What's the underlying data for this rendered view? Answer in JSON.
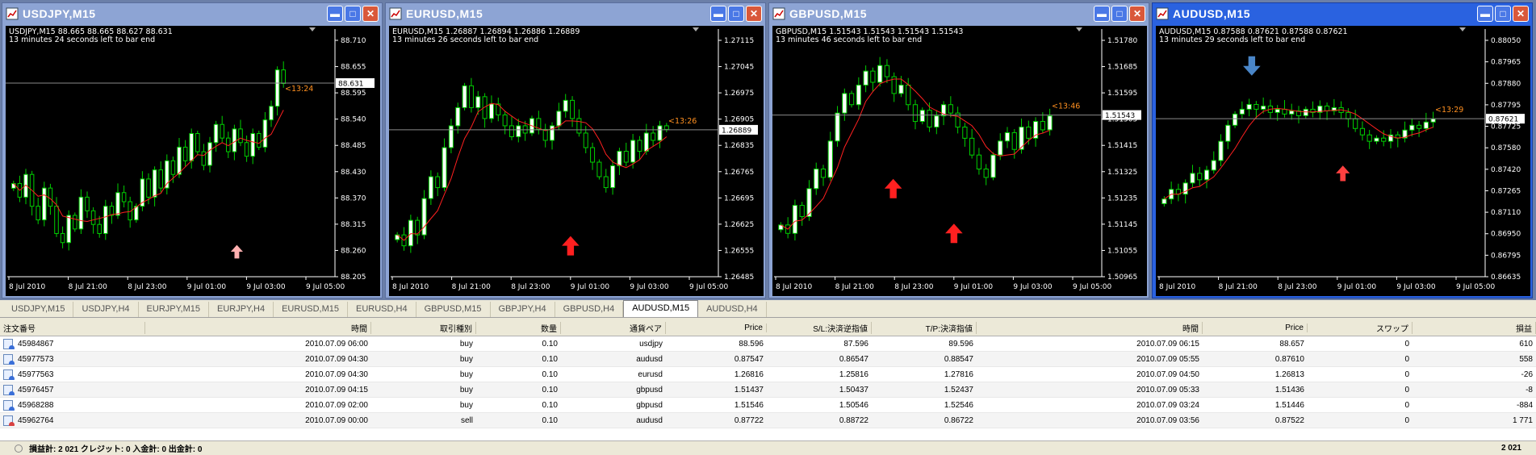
{
  "windows": [
    {
      "title": "USDJPY,M15",
      "active": false,
      "header_line": "USDJPY,M15  88.665 88.665 88.627 88.631",
      "timer_text": "13 minutes 24 seconds left to bar end",
      "price_labels": [
        "88.710",
        "88.655",
        "88.595",
        "88.540",
        "88.485",
        "88.430",
        "88.370",
        "88.315",
        "88.260",
        "88.205"
      ],
      "ymin": 88.205,
      "ymax": 88.725,
      "current_price": "88.631",
      "current_value": 88.631,
      "countdown": "<13:24",
      "time_labels": [
        "8 Jul 2010",
        "8 Jul 21:00",
        "8 Jul 23:00",
        "9 Jul 01:00",
        "9 Jul 03:00",
        "9 Jul 05:00"
      ],
      "closes": [
        88.41,
        88.38,
        88.43,
        88.36,
        88.33,
        88.4,
        88.36,
        88.3,
        88.28,
        88.34,
        88.31,
        88.38,
        88.35,
        88.32,
        88.3,
        88.36,
        88.34,
        88.39,
        88.37,
        88.33,
        88.36,
        88.42,
        88.38,
        88.44,
        88.4,
        88.46,
        88.43,
        88.49,
        88.46,
        88.52,
        88.48,
        88.45,
        88.5,
        88.54,
        88.51,
        88.48,
        88.53,
        88.5,
        88.47,
        88.52,
        88.49,
        88.55,
        88.58,
        88.66,
        88.63
      ],
      "arrows": [
        {
          "dir": "up",
          "at": 0.82,
          "level": 88.26,
          "color": "#ffb0b0",
          "size": 0.7
        }
      ]
    },
    {
      "title": "EURUSD,M15",
      "active": false,
      "header_line": "EURUSD,M15  1.26887 1.26894 1.26886 1.26889",
      "timer_text": "13 minutes 26 seconds left to bar end",
      "price_labels": [
        "1.27115",
        "1.27045",
        "1.26975",
        "1.26905",
        "1.26835",
        "1.26765",
        "1.26695",
        "1.26625",
        "1.26555",
        "1.26485"
      ],
      "ymin": 1.26485,
      "ymax": 1.27135,
      "current_price": "1.26889",
      "current_value": 1.26889,
      "countdown": "<13:26",
      "time_labels": [
        "8 Jul 2010",
        "8 Jul 21:00",
        "8 Jul 23:00",
        "9 Jul 01:00",
        "9 Jul 03:00",
        "9 Jul 05:00"
      ],
      "closes": [
        1.266,
        1.2657,
        1.2664,
        1.266,
        1.267,
        1.2676,
        1.2673,
        1.2684,
        1.269,
        1.2695,
        1.2701,
        1.2695,
        1.2698,
        1.2692,
        1.2696,
        1.2693,
        1.269,
        1.2687,
        1.269,
        1.2688,
        1.2692,
        1.2689,
        1.2686,
        1.269,
        1.2694,
        1.2697,
        1.2692,
        1.2688,
        1.2684,
        1.268,
        1.2676,
        1.2673,
        1.2679,
        1.2683,
        1.268,
        1.2686,
        1.2683,
        1.2688,
        1.2686,
        1.269,
        1.2689
      ],
      "arrows": [
        {
          "dir": "up",
          "at": 0.64,
          "level": 1.2657,
          "color": "#ff2020",
          "size": 1
        }
      ]
    },
    {
      "title": "GBPUSD,M15",
      "active": false,
      "header_line": "GBPUSD,M15  1.51543 1.51543 1.51543 1.51543",
      "timer_text": "13 minutes 46 seconds left to bar end",
      "price_labels": [
        "1.51780",
        "1.51685",
        "1.51595",
        "1.51505",
        "1.51415",
        "1.51325",
        "1.51235",
        "1.51145",
        "1.51055",
        "1.50965"
      ],
      "ymin": 1.50965,
      "ymax": 1.5181,
      "current_price": "1.51543",
      "current_value": 1.51543,
      "countdown": "<13:46",
      "time_labels": [
        "8 Jul 2010",
        "8 Jul 21:00",
        "8 Jul 23:00",
        "9 Jul 01:00",
        "9 Jul 03:00",
        "9 Jul 05:00"
      ],
      "closes": [
        1.5115,
        1.5112,
        1.5122,
        1.5118,
        1.5128,
        1.5135,
        1.5132,
        1.5145,
        1.5155,
        1.5162,
        1.5158,
        1.5165,
        1.517,
        1.5166,
        1.5172,
        1.5168,
        1.5162,
        1.5165,
        1.5158,
        1.5152,
        1.5156,
        1.515,
        1.5154,
        1.5158,
        1.5155,
        1.515,
        1.5146,
        1.514,
        1.5135,
        1.5132,
        1.514,
        1.5145,
        1.5148,
        1.5142,
        1.515,
        1.5146,
        1.5152,
        1.5149,
        1.5154
      ],
      "arrows": [
        {
          "dir": "up",
          "at": 0.42,
          "level": 1.5128,
          "color": "#ff2020",
          "size": 1
        },
        {
          "dir": "up",
          "at": 0.64,
          "level": 1.5112,
          "color": "#ff2020",
          "size": 1
        }
      ]
    },
    {
      "title": "AUDUSD,M15",
      "active": true,
      "header_line": "AUDUSD,M15  0.87588 0.87621 0.87588 0.87621",
      "timer_text": "13 minutes 29 seconds left to bar end",
      "price_labels": [
        "0.88050",
        "0.87965",
        "0.87880",
        "0.87795",
        "0.87725",
        "0.87580",
        "0.87420",
        "0.87265",
        "0.87110",
        "0.86950",
        "0.86795",
        "0.86635"
      ],
      "ymin": 0.86635,
      "ymax": 0.8811,
      "current_price": "0.87621",
      "current_value": 0.87621,
      "countdown": "<13:29",
      "time_labels": [
        "8 Jul 2010",
        "8 Jul 21:00",
        "8 Jul 23:00",
        "9 Jul 01:00",
        "9 Jul 03:00",
        "9 Jul 05:00"
      ],
      "closes": [
        0.8712,
        0.8718,
        0.8715,
        0.8722,
        0.8728,
        0.8724,
        0.873,
        0.8736,
        0.8748,
        0.8758,
        0.8765,
        0.8768,
        0.8771,
        0.8768,
        0.877,
        0.8766,
        0.8768,
        0.8765,
        0.8767,
        0.8764,
        0.8768,
        0.8766,
        0.877,
        0.8767,
        0.8769,
        0.8766,
        0.8762,
        0.8756,
        0.8752,
        0.8748,
        0.875,
        0.8748,
        0.8752,
        0.875,
        0.8755,
        0.8758,
        0.8756,
        0.876,
        0.8762
      ],
      "arrows": [
        {
          "dir": "down",
          "at": 0.33,
          "level": 0.8795,
          "color": "#4a86c8",
          "size": 1
        },
        {
          "dir": "up",
          "at": 0.66,
          "level": 0.8728,
          "color": "#ff4040",
          "size": 0.8
        }
      ]
    }
  ],
  "tabs": [
    {
      "label": "USDJPY,M15",
      "active": false
    },
    {
      "label": "USDJPY,H4",
      "active": false
    },
    {
      "label": "EURJPY,M15",
      "active": false
    },
    {
      "label": "EURJPY,H4",
      "active": false
    },
    {
      "label": "EURUSD,M15",
      "active": false
    },
    {
      "label": "EURUSD,H4",
      "active": false
    },
    {
      "label": "GBPUSD,M15",
      "active": false
    },
    {
      "label": "GBPJPY,H4",
      "active": false
    },
    {
      "label": "GBPUSD,H4",
      "active": false
    },
    {
      "label": "AUDUSD,M15",
      "active": true
    },
    {
      "label": "AUDUSD,H4",
      "active": false
    }
  ],
  "table": {
    "columns": [
      "注文番号",
      "時間",
      "取引種別",
      "数量",
      "通貨ペア",
      "Price",
      "S/L:決済逆指値",
      "T/P:決済指値",
      "時間",
      "Price",
      "スワップ",
      "損益"
    ],
    "rows": [
      {
        "type": "buy",
        "cells": [
          "45984867",
          "2010.07.09 06:00",
          "buy",
          "0.10",
          "usdjpy",
          "88.596",
          "87.596",
          "89.596",
          "2010.07.09 06:15",
          "88.657",
          "0",
          "610"
        ]
      },
      {
        "type": "buy",
        "cells": [
          "45977573",
          "2010.07.09 04:30",
          "buy",
          "0.10",
          "audusd",
          "0.87547",
          "0.86547",
          "0.88547",
          "2010.07.09 05:55",
          "0.87610",
          "0",
          "558"
        ]
      },
      {
        "type": "buy",
        "cells": [
          "45977563",
          "2010.07.09 04:30",
          "buy",
          "0.10",
          "eurusd",
          "1.26816",
          "1.25816",
          "1.27816",
          "2010.07.09 04:50",
          "1.26813",
          "0",
          "-26"
        ]
      },
      {
        "type": "buy",
        "cells": [
          "45976457",
          "2010.07.09 04:15",
          "buy",
          "0.10",
          "gbpusd",
          "1.51437",
          "1.50437",
          "1.52437",
          "2010.07.09 05:33",
          "1.51436",
          "0",
          "-8"
        ]
      },
      {
        "type": "buy",
        "cells": [
          "45968288",
          "2010.07.09 02:00",
          "buy",
          "0.10",
          "gbpusd",
          "1.51546",
          "1.50546",
          "1.52546",
          "2010.07.09 03:24",
          "1.51446",
          "0",
          "-884"
        ]
      },
      {
        "type": "sell",
        "cells": [
          "45962764",
          "2010.07.09 00:00",
          "sell",
          "0.10",
          "audusd",
          "0.87722",
          "0.88722",
          "0.86722",
          "2010.07.09 03:56",
          "0.87522",
          "0",
          "1 771"
        ]
      }
    ]
  },
  "status": {
    "summary": "損益計: 2 021  クレジット: 0  入金計: 0  出金計: 0",
    "total": "2 021"
  },
  "colors": {
    "bull": "#ffffff",
    "bear": "#000000",
    "wick": "#00d000",
    "ma": "#ff2020",
    "countdown": "#ff9020"
  }
}
